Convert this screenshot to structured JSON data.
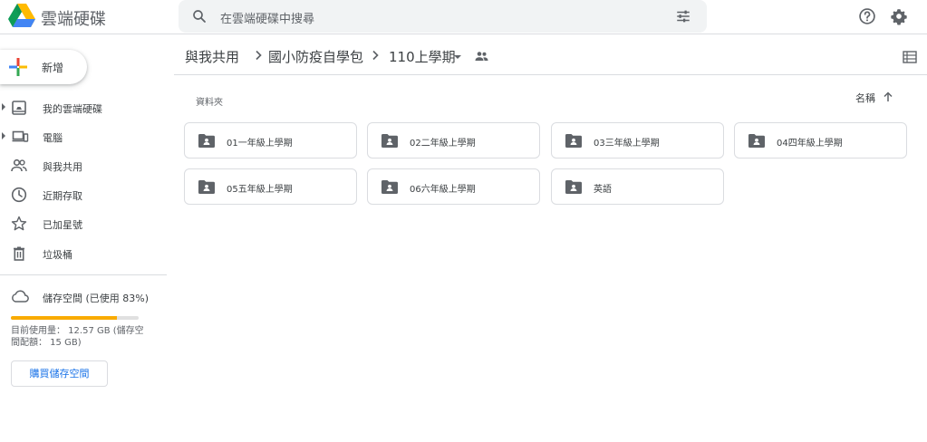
{
  "header": {
    "app_title": "雲端硬碟",
    "search_placeholder": "在雲端硬碟中搜尋",
    "logo_icon": "google-drive-logo",
    "search_icon": "search-icon",
    "filter_icon": "search-options-icon",
    "help_icon": "help-icon",
    "settings_icon": "gear-icon"
  },
  "sidebar": {
    "new_label": "新增",
    "items": [
      {
        "label": "我的雲端硬碟",
        "icon": "my-drive-icon",
        "expandable": true
      },
      {
        "label": "電腦",
        "icon": "computer-icon",
        "expandable": true
      },
      {
        "label": "與我共用",
        "icon": "shared-people-icon",
        "expandable": false
      },
      {
        "label": "近期存取",
        "icon": "clock-icon",
        "expandable": false
      },
      {
        "label": "已加星號",
        "icon": "star-icon",
        "expandable": false
      },
      {
        "label": "垃圾桶",
        "icon": "trash-icon",
        "expandable": false
      }
    ],
    "storage": {
      "label": "儲存空間 (已使用 83%)",
      "used_fraction": 0.83,
      "usage_text": "目前使用量： 12.57 GB (儲存空間配額： 15 GB)",
      "buy_label": "購買儲存空間"
    }
  },
  "breadcrumb": {
    "items": [
      "與我共用",
      "國小防疫自學包",
      "110上學期"
    ]
  },
  "main": {
    "section_label": "資料夾",
    "sort_label": "名稱",
    "folders": [
      "01一年級上學期",
      "02二年級上學期",
      "03三年級上學期",
      "04四年級上學期",
      "05五年級上學期",
      "06六年級上學期",
      "英語"
    ]
  },
  "colors": {
    "accent": "#1a73e8",
    "storage_fill": "#f9ab00",
    "divider": "#dadce0",
    "icon_gray": "#5f6368"
  }
}
